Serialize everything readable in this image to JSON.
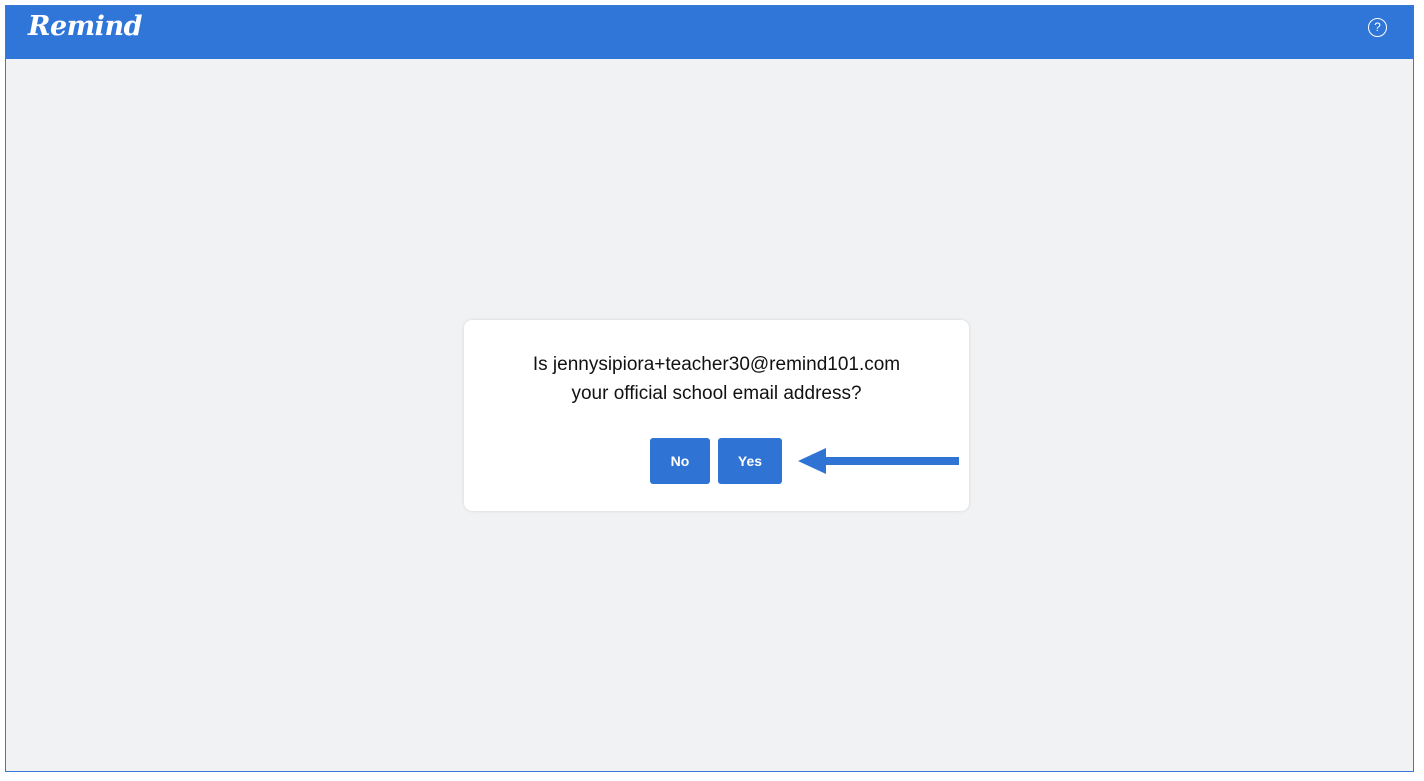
{
  "header": {
    "logo_text": "Remind",
    "help_glyph": "?",
    "help_icon": "question-circle-icon",
    "background_color": "#3076d8"
  },
  "dialog": {
    "question_line1": "Is jennysipiora+teacher30@remind101.com",
    "question_line2": "your official school email address?",
    "no_label": "No",
    "yes_label": "Yes",
    "button_color": "#2f74d4"
  },
  "annotation": {
    "arrow_icon": "arrow-left-icon",
    "arrow_color": "#2f74d4"
  }
}
